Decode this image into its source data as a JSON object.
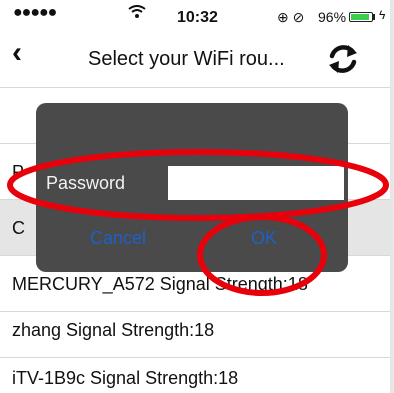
{
  "status_bar": {
    "signal": "●●●●●",
    "wifi_icon": "wifi-icon",
    "time": "10:32",
    "right_icons": "⊕ ⊘",
    "battery_pct": "96%",
    "battery_level": 0.96,
    "battery_color": "#3ccf4e"
  },
  "nav": {
    "title": "Select your WiFi rou...",
    "back_icon": "chevron-left-icon",
    "refresh_icon": "refresh-icon"
  },
  "list": {
    "items": [
      {
        "label": ""
      },
      {
        "label": "P"
      },
      {
        "label": "C"
      },
      {
        "label": "MERCURY_A572 Signal Strength:18"
      },
      {
        "label": "zhang Signal Strength:18"
      },
      {
        "label": "iTV-1B9c Signal Strength:18"
      }
    ]
  },
  "dialog": {
    "password_label": "Password",
    "password_value": "",
    "cancel_label": "Cancel",
    "ok_label": "OK",
    "button_color": "#1d60c8"
  },
  "annotations": {
    "color": "#e8000b",
    "marks": [
      "password-highlight-ellipse",
      "ok-highlight-ellipse"
    ]
  }
}
